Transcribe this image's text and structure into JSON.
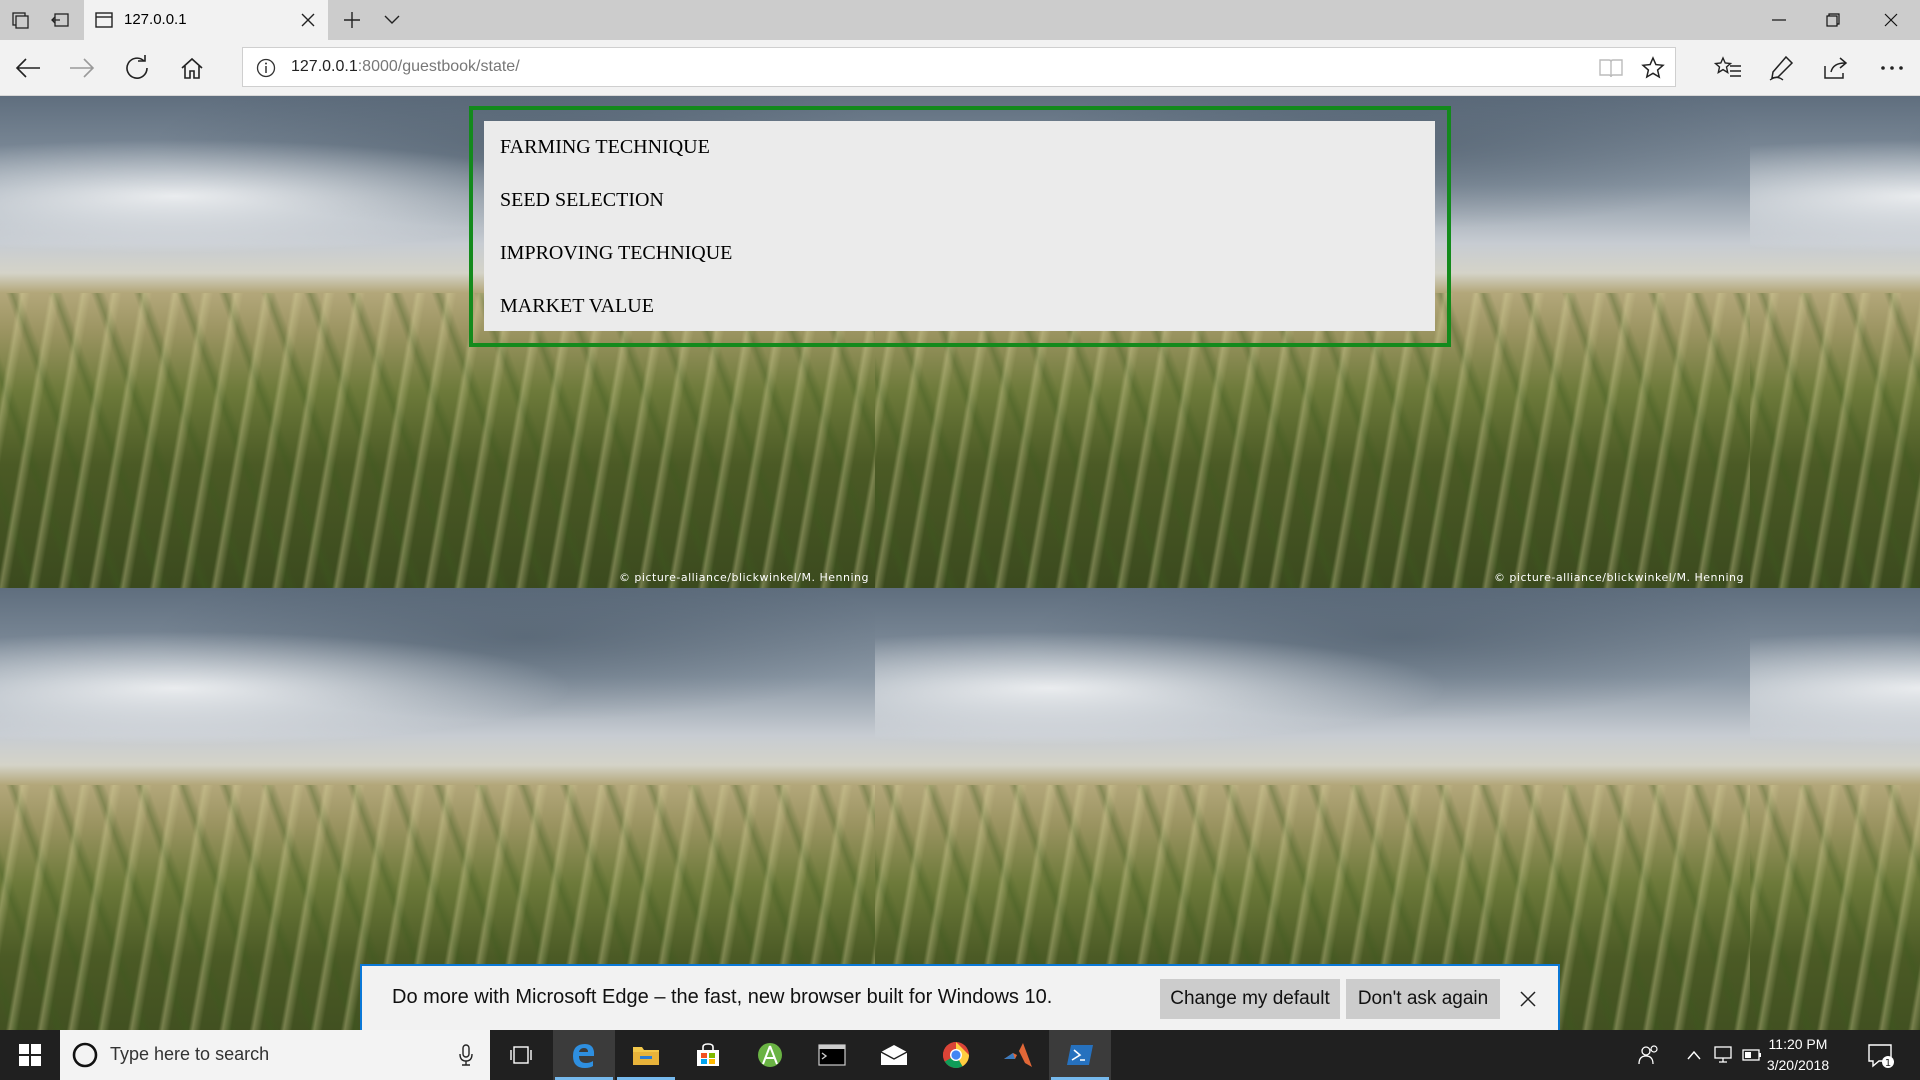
{
  "browser": {
    "tab_title": "127.0.0.1",
    "url_host": "127.0.0.1",
    "url_path": ":8000/guestbook/state/"
  },
  "page": {
    "menu_items": [
      "FARMING TECHNIQUE",
      "SEED SELECTION",
      "IMPROVING TECHNIQUE",
      "MARKET VALUE"
    ],
    "photo_credit": "© picture-alliance/blickwinkel/M. Henning"
  },
  "notification": {
    "message": "Do more with Microsoft Edge – the fast, new browser built for Windows 10.",
    "change_default_label": "Change my default",
    "dont_ask_label": "Don't ask again"
  },
  "taskbar": {
    "search_placeholder": "Type here to search",
    "time": "11:20 PM",
    "date": "3/20/2018",
    "notification_count": "1",
    "apps": [
      "task-view",
      "edge",
      "file-explorer",
      "store",
      "android-studio",
      "cmd",
      "mail",
      "chrome",
      "matlab",
      "powershell"
    ]
  },
  "colors": {
    "menu_border": "#138a1c",
    "notification_border": "#0a78d7",
    "taskbar_accent": "#76b9ed"
  }
}
